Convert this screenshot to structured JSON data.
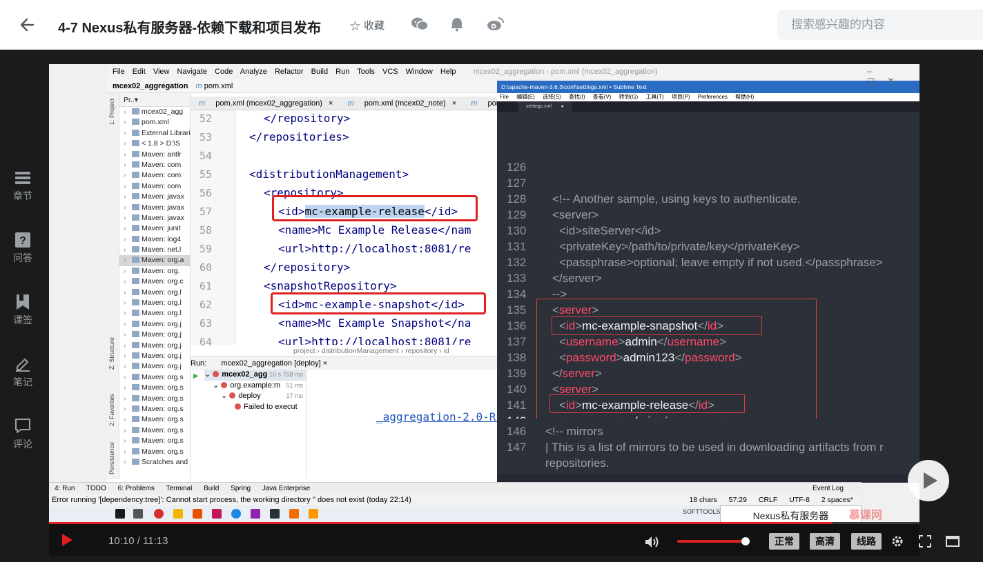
{
  "header": {
    "back_icon": "arrow-left-icon",
    "title": "4-7 Nexus私有服务器-依赖下载和项目发布",
    "favorite_label": "收藏",
    "share_icons": [
      "wechat-icon",
      "bell-icon",
      "weibo-icon"
    ],
    "search_placeholder": "搜索感兴趣的内容"
  },
  "rail": [
    {
      "label": "章节",
      "icon": "chapters-icon"
    },
    {
      "label": "问答",
      "icon": "question-icon"
    },
    {
      "label": "课签",
      "icon": "bookmark-icon"
    },
    {
      "label": "笔记",
      "icon": "pen-icon"
    },
    {
      "label": "评论",
      "icon": "comment-icon"
    }
  ],
  "ide": {
    "menu": [
      "File",
      "Edit",
      "View",
      "Navigate",
      "Code",
      "Analyze",
      "Refactor",
      "Build",
      "Run",
      "Tools",
      "VCS",
      "Window",
      "Help"
    ],
    "window_title": "mcex02_aggregation - pom.xml (mcex02_aggregation)",
    "crumb_project": "mcex02_aggregation",
    "crumb_file": "pom.xml",
    "project_header": "Pr..▾",
    "project_rows": [
      {
        "text": "mcex02_agg",
        "sel": false
      },
      {
        "text": "pom.xml",
        "sel": false
      },
      {
        "text": "External Librarie",
        "sel": false
      },
      {
        "text": "< 1.8 > D:\\S",
        "sel": false
      },
      {
        "text": "Maven: antlr",
        "sel": false
      },
      {
        "text": "Maven: com",
        "sel": false
      },
      {
        "text": "Maven: com",
        "sel": false
      },
      {
        "text": "Maven: com",
        "sel": false
      },
      {
        "text": "Maven: javax",
        "sel": false
      },
      {
        "text": "Maven: javax",
        "sel": false
      },
      {
        "text": "Maven: javax",
        "sel": false
      },
      {
        "text": "Maven: junit",
        "sel": false
      },
      {
        "text": "Maven: log4",
        "sel": false
      },
      {
        "text": "Maven: net.l",
        "sel": false
      },
      {
        "text": "Maven: org.a",
        "sel": true
      },
      {
        "text": "Maven: org.",
        "sel": false
      },
      {
        "text": "Maven: org.c",
        "sel": false
      },
      {
        "text": "Maven: org.l",
        "sel": false
      },
      {
        "text": "Maven: org.l",
        "sel": false
      },
      {
        "text": "Maven: org.l",
        "sel": false
      },
      {
        "text": "Maven: org.j",
        "sel": false
      },
      {
        "text": "Maven: org.j",
        "sel": false
      },
      {
        "text": "Maven: org.j",
        "sel": false
      },
      {
        "text": "Maven: org.j",
        "sel": false
      },
      {
        "text": "Maven: org.j",
        "sel": false
      },
      {
        "text": "Maven: org.s",
        "sel": false
      },
      {
        "text": "Maven: org.s",
        "sel": false
      },
      {
        "text": "Maven: org.s",
        "sel": false
      },
      {
        "text": "Maven: org.s",
        "sel": false
      },
      {
        "text": "Maven: org.s",
        "sel": false
      },
      {
        "text": "Maven: org.s",
        "sel": false
      },
      {
        "text": "Maven: org.s",
        "sel": false
      },
      {
        "text": "Maven: org.s",
        "sel": false
      },
      {
        "text": "Scratches and C",
        "sel": false
      }
    ],
    "side_labels": [
      "1: Project",
      "Z: Structure",
      "2: Favorites",
      "Persistence"
    ],
    "tabs": [
      "pom.xml (mcex02_aggregation)",
      "pom.xml (mcex02_note)",
      "pom.xml (mcex02_w"
    ],
    "line_numbers": [
      "52",
      "53",
      "54",
      "55",
      "56",
      "57",
      "58",
      "59",
      "60",
      "61",
      "62",
      "63",
      "64"
    ],
    "lines": {
      "l52": "</repository>",
      "l53": "</repositories>",
      "l55": "<distributionManagement>",
      "l56": "<repository>",
      "l57_open": "<id>",
      "l57_val": "mc-example-release",
      "l57_close": "</id>",
      "l58": "<name>Mc Example Release</nam",
      "l59": "<url>http://localhost:8081/re",
      "l60": "</repository>",
      "l61": "<snapshotRepository>",
      "l62": "<id>mc-example-snapshot</id>",
      "l63": "<name>Mc Example Snapshot</na",
      "l64": "<url>http://localhost:8081/re"
    },
    "nav_crumb": "project  ›  distributionManagement  ›  repository  ›  id",
    "run_label": "Run:",
    "run_tab": "mcex02_aggregation [deploy]",
    "run_tree": [
      {
        "text": "mcex02_agg",
        "time": "10 s 768 ms"
      },
      {
        "text": "org.example:m",
        "time": "51 ms"
      },
      {
        "text": "deploy",
        "time": "17 ms"
      },
      {
        "text": "Failed to execut",
        "time": ""
      }
    ],
    "artifact_text": "_aggregation-2.0-RELEASE.",
    "toolwindows": [
      "4: Run",
      "TODO",
      "6: Problems",
      "Terminal",
      "Build",
      "Spring",
      "Java Enterprise"
    ],
    "event_log": "Event Log",
    "status_message": "Error running '[dependency:tree]': Cannot start process, the working directory '' does not exist (today 22:14)",
    "status_right": [
      "18 chars",
      "57:29",
      "CRLF",
      "UTF-8",
      "2 spaces*"
    ],
    "taskbar_softtools": "SOFTTOOLS",
    "taskbar_card": "Nexus私有服务器"
  },
  "sublime": {
    "title": "D:\\apache-maven-3.6.3\\conf\\settings.xml • Sublime Text",
    "menu": [
      "File",
      "编辑(E)",
      "选择(S)",
      "查找(I)",
      "查看(V)",
      "转到(G)",
      "工具(T)",
      "项目(P)",
      "Preferences",
      "帮助(H)"
    ],
    "tab": "settings.xml",
    "line_numbers": [
      "126",
      "127",
      "128",
      "129",
      "130",
      "131",
      "132",
      "133",
      "134",
      "135",
      "136",
      "137",
      "138",
      "139",
      "140",
      "141",
      "142",
      "143",
      "144",
      "145",
      "146",
      "147"
    ],
    "current_line": "142",
    "l127": "<!-- Another sample, using keys to authenticate.",
    "l128": "<server>",
    "l129": "<id>siteServer</id>",
    "l130": "<privateKey>/path/to/private/key</privateKey>",
    "l131": "<passphrase>optional; leave empty if not used.</passphrase>",
    "l132": "</server>",
    "l133": "-->",
    "server_tag": "server",
    "id_tag": "id",
    "username_tag": "username",
    "password_tag": "password",
    "servers_tag": "servers",
    "snapshot_id": "mc-example-snapshot",
    "release_id": "mc-example-release",
    "username_value": "admin",
    "password_value": "admin123",
    "l146": "<!-- mirrors",
    "l147": "| This is a list of mirrors to be used in downloading artifacts from r",
    "l147b": "repositories."
  },
  "player": {
    "time": "10:10 / 11:13",
    "progress": 0.9,
    "volume": 0.93,
    "btn_speed": "正常",
    "btn_quality": "高清",
    "btn_line": "线路",
    "watermark": "慕课网"
  }
}
